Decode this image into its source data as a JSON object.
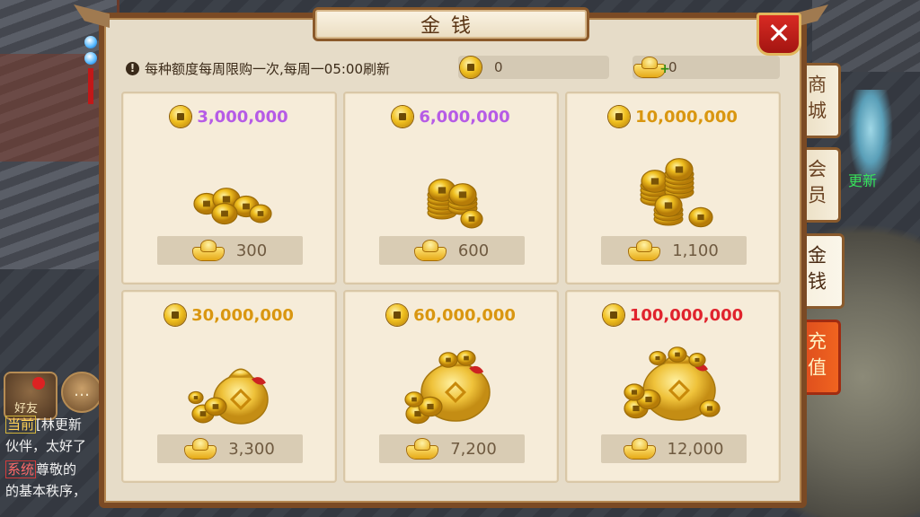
{
  "background": {
    "right_label": "更新",
    "chat": {
      "friend_label": "好友",
      "lines": [
        {
          "tag": "当前",
          "text": "[林更新"
        },
        {
          "tag": "",
          "text": "伙伴，太好了"
        },
        {
          "tag": "系统",
          "text": "尊敬的"
        },
        {
          "tag": "",
          "text": "的基本秩序，"
        }
      ]
    }
  },
  "panel": {
    "title": "金钱",
    "close_symbol": "✕",
    "notice": "每种额度每周限购一次,每周一05:00刷新",
    "balances": {
      "coins": "0",
      "ingots": "0"
    }
  },
  "tabs": [
    {
      "label": "商城",
      "state": "normal"
    },
    {
      "label": "会员",
      "state": "normal"
    },
    {
      "label": "金钱",
      "state": "active"
    },
    {
      "label": "充值",
      "state": "recharge"
    }
  ],
  "items": [
    {
      "coins": "3,000,000",
      "color": "purple",
      "cost": "300",
      "art": "coin-pile-small-icon"
    },
    {
      "coins": "6,000,000",
      "color": "purple",
      "cost": "600",
      "art": "coin-stack-icon"
    },
    {
      "coins": "10,000,000",
      "color": "gold",
      "cost": "1,100",
      "art": "coin-stacks-icon"
    },
    {
      "coins": "30,000,000",
      "color": "gold",
      "cost": "3,300",
      "art": "coin-bag-small-icon"
    },
    {
      "coins": "60,000,000",
      "color": "gold",
      "cost": "7,200",
      "art": "coin-bag-medium-icon"
    },
    {
      "coins": "100,000,000",
      "color": "red",
      "cost": "12,000",
      "art": "coin-bag-large-icon"
    }
  ],
  "colors": {
    "purple": "#b65be6",
    "gold": "#d99611",
    "red": "#e0232d"
  }
}
